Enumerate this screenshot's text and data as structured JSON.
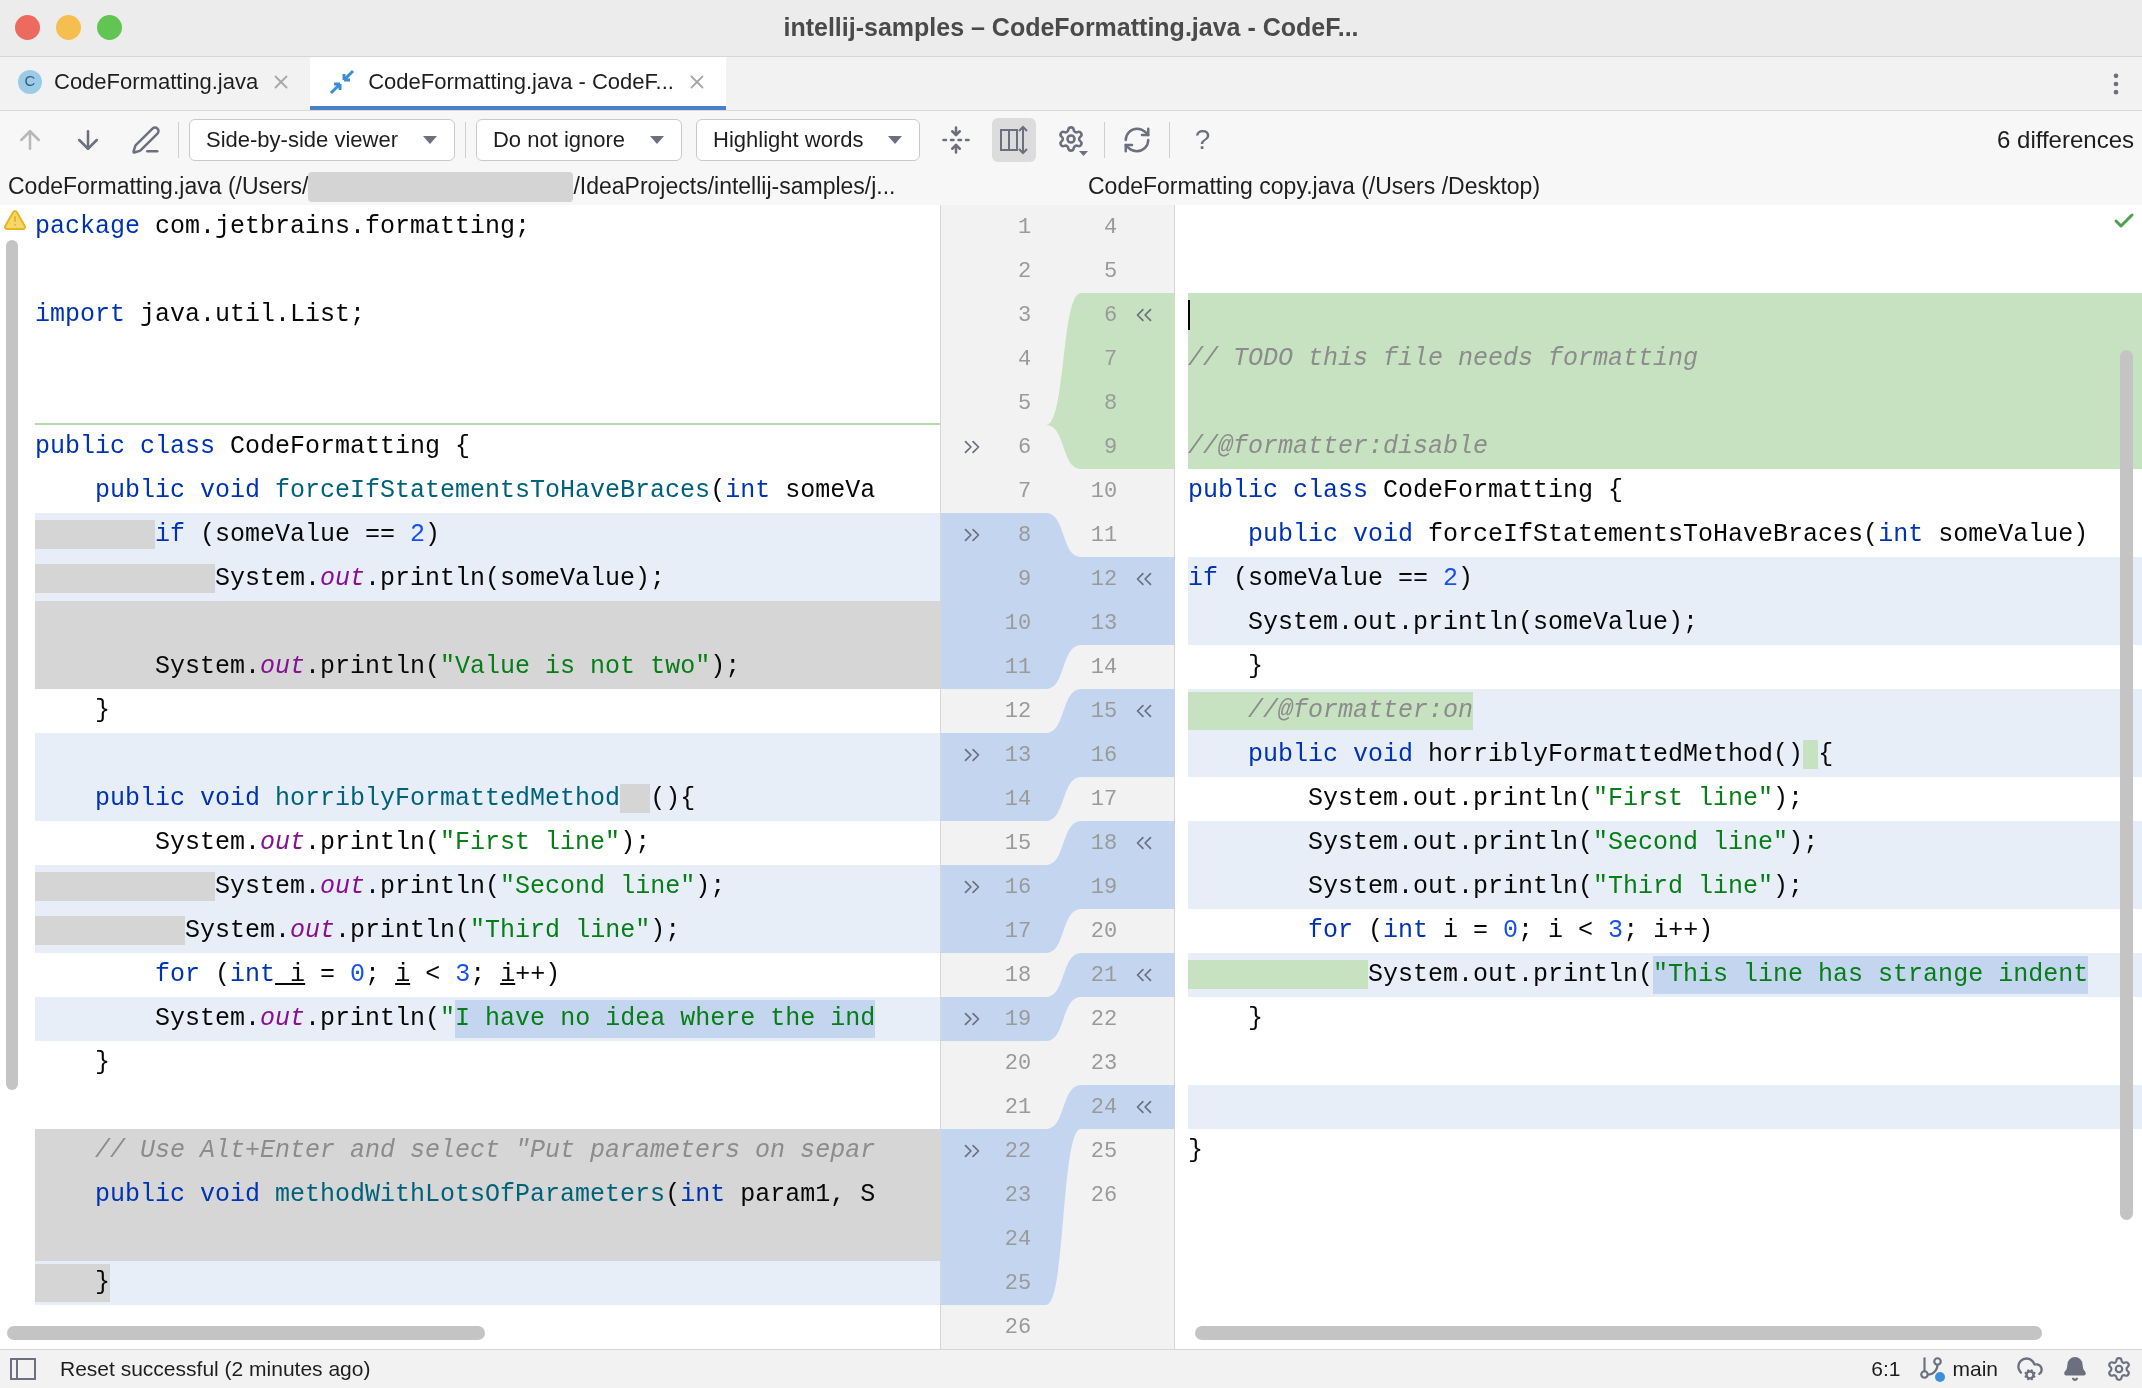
{
  "window": {
    "title": "intellij-samples – CodeFormatting.java - CodeF..."
  },
  "tabs": [
    {
      "label": "CodeFormatting.java",
      "kind": "java_file",
      "icon_text": "C",
      "selected": false
    },
    {
      "label": "CodeFormatting.java - CodeF...",
      "kind": "diff",
      "selected": true
    }
  ],
  "toolbar": {
    "groups": [
      [
        {
          "kind": "prev",
          "disabled": true
        },
        {
          "kind": "next",
          "disabled": false
        },
        {
          "kind": "edit",
          "disabled": false
        }
      ],
      [
        {
          "kind": "dropdown",
          "label": "Side-by-side viewer"
        }
      ],
      [
        {
          "kind": "dropdown",
          "label": "Do not ignore"
        },
        {
          "kind": "dropdown",
          "label": "Highlight words"
        },
        {
          "kind": "collapse",
          "selected": false
        },
        {
          "kind": "sync_scroll",
          "selected": true
        },
        {
          "kind": "settings"
        }
      ],
      [
        {
          "kind": "refresh"
        }
      ],
      [
        {
          "kind": "help",
          "label": "?"
        }
      ]
    ],
    "summary": "6 differences"
  },
  "left": {
    "header_start": "CodeFormatting.java (/Users/",
    "header_end": "/IdeaProjects/intellij-samples/j...",
    "warning": true,
    "lines": [
      {
        "number": "1",
        "kind": "same",
        "tokens": [
          {
            "text": "package",
            "kind": "keyword"
          },
          {
            "text": " com.jetbrains.formatting;",
            "kind": "plain"
          }
        ]
      },
      {
        "number": "2",
        "kind": "same"
      },
      {
        "number": "3",
        "kind": "same",
        "tokens": [
          {
            "text": "import",
            "kind": "keyword"
          },
          {
            "text": " java.util.List;",
            "kind": "plain"
          }
        ]
      },
      {
        "number": "4",
        "kind": "same"
      },
      {
        "number": "5",
        "kind": "same",
        "gap_after": true
      },
      {
        "number": "6",
        "kind": "same",
        "tokens": [
          {
            "text": "public class",
            "kind": "keyword"
          },
          {
            "text": " CodeFormatting {",
            "kind": "plain"
          }
        ]
      },
      {
        "number": "7",
        "kind": "same",
        "tokens": [
          {
            "text": "    public void",
            "kind": "keyword"
          },
          {
            "text": " forceIfStatementsToHaveBraces",
            "kind": "method"
          },
          {
            "text": "(",
            "kind": "plain"
          },
          {
            "text": "int",
            "kind": "keyword"
          },
          {
            "text": " someVa",
            "kind": "plain"
          }
        ]
      },
      {
        "number": "8",
        "kind": "modified",
        "tokens": [
          {
            "text": "        if",
            "kind": "keyword",
            "space_removed": true
          },
          {
            "text": " (someValue == ",
            "kind": "plain"
          },
          {
            "text": "2",
            "kind": "number"
          },
          {
            "text": ")",
            "kind": "plain"
          }
        ]
      },
      {
        "number": "9",
        "kind": "modified",
        "tokens": [
          {
            "text": "            System.",
            "kind": "plain",
            "space_removed": true
          },
          {
            "text": "out",
            "kind": "field"
          },
          {
            "text": ".println(someValue);",
            "kind": "plain"
          }
        ]
      },
      {
        "number": "10",
        "kind": "removed"
      },
      {
        "number": "11",
        "kind": "removed",
        "tokens": [
          {
            "text": "        System.",
            "kind": "plain"
          },
          {
            "text": "out",
            "kind": "field"
          },
          {
            "text": ".println(",
            "kind": "plain"
          },
          {
            "text": "\"Value is not two\"",
            "kind": "string"
          },
          {
            "text": ");",
            "kind": "plain"
          }
        ]
      },
      {
        "number": "12",
        "kind": "same",
        "tokens": [
          {
            "text": "    }",
            "kind": "plain"
          }
        ]
      },
      {
        "number": "13",
        "kind": "modified"
      },
      {
        "number": "14",
        "kind": "modified",
        "tokens": [
          {
            "text": "    public void",
            "kind": "keyword"
          },
          {
            "text": " horriblyFormattedMethod",
            "kind": "method"
          },
          {
            "text": "  (){",
            "kind": "plain",
            "space_removed": true
          }
        ]
      },
      {
        "number": "15",
        "kind": "same",
        "tokens": [
          {
            "text": "        System.",
            "kind": "plain"
          },
          {
            "text": "out",
            "kind": "field"
          },
          {
            "text": ".println(",
            "kind": "plain"
          },
          {
            "text": "\"First line\"",
            "kind": "string"
          },
          {
            "text": ");",
            "kind": "plain"
          }
        ]
      },
      {
        "number": "16",
        "kind": "modified",
        "tokens": [
          {
            "text": "            System.",
            "kind": "plain",
            "space_removed": true
          },
          {
            "text": "out",
            "kind": "field"
          },
          {
            "text": ".println(",
            "kind": "plain"
          },
          {
            "text": "\"Second line\"",
            "kind": "string"
          },
          {
            "text": ");",
            "kind": "plain"
          }
        ]
      },
      {
        "number": "17",
        "kind": "modified",
        "tokens": [
          {
            "text": "          System.",
            "kind": "plain",
            "space_removed": true
          },
          {
            "text": "out",
            "kind": "field"
          },
          {
            "text": ".println(",
            "kind": "plain"
          },
          {
            "text": "\"Third line\"",
            "kind": "string"
          },
          {
            "text": ");",
            "kind": "plain"
          }
        ]
      },
      {
        "number": "18",
        "kind": "same",
        "tokens": [
          {
            "text": "        for",
            "kind": "keyword"
          },
          {
            "text": " (",
            "kind": "plain"
          },
          {
            "text": "int",
            "kind": "keyword"
          },
          {
            "text": " i",
            "kind": "local"
          },
          {
            "text": " = ",
            "kind": "plain"
          },
          {
            "text": "0",
            "kind": "number"
          },
          {
            "text": "; ",
            "kind": "plain"
          },
          {
            "text": "i",
            "kind": "local"
          },
          {
            "text": " < ",
            "kind": "plain"
          },
          {
            "text": "3",
            "kind": "number"
          },
          {
            "text": "; ",
            "kind": "plain"
          },
          {
            "text": "i",
            "kind": "local"
          },
          {
            "text": "++)",
            "kind": "plain"
          }
        ]
      },
      {
        "number": "19",
        "kind": "modified",
        "tokens": [
          {
            "text": "        System.",
            "kind": "plain"
          },
          {
            "text": "out",
            "kind": "field"
          },
          {
            "text": ".println(",
            "kind": "plain"
          },
          {
            "text": "\"",
            "kind": "string"
          },
          {
            "text": "I have no idea where the ind",
            "kind": "string",
            "changed": true
          }
        ]
      },
      {
        "number": "20",
        "kind": "same",
        "tokens": [
          {
            "text": "    }",
            "kind": "plain"
          }
        ]
      },
      {
        "number": "21",
        "kind": "same"
      },
      {
        "number": "22",
        "kind": "removed",
        "tokens": [
          {
            "text": "    // Use Alt+Enter and select \"Put parameters on separ",
            "kind": "comment"
          }
        ]
      },
      {
        "number": "23",
        "kind": "removed",
        "tokens": [
          {
            "text": "    public void",
            "kind": "keyword"
          },
          {
            "text": " methodWithLotsOfParameters",
            "kind": "method"
          },
          {
            "text": "(",
            "kind": "plain"
          },
          {
            "text": "int",
            "kind": "keyword"
          },
          {
            "text": " param1, S",
            "kind": "plain"
          }
        ]
      },
      {
        "number": "24",
        "kind": "removed"
      },
      {
        "number": "25",
        "kind": "modified",
        "tokens": [
          {
            "text": "    }",
            "kind": "plain",
            "removed": true
          }
        ]
      },
      {
        "number": "26",
        "kind": "same"
      }
    ]
  },
  "right": {
    "header": "CodeFormatting copy.java (/Users /Desktop)",
    "ok": true,
    "lines": [
      {
        "number": "4",
        "kind": "same"
      },
      {
        "number": "5",
        "kind": "same"
      },
      {
        "number": "6",
        "kind": "inserted",
        "cursor": true
      },
      {
        "number": "7",
        "kind": "inserted",
        "tokens": [
          {
            "text": "// TODO this file needs formatting",
            "kind": "comment"
          }
        ]
      },
      {
        "number": "8",
        "kind": "inserted"
      },
      {
        "number": "9",
        "kind": "inserted",
        "tokens": [
          {
            "text": "//@formatter:disable",
            "kind": "comment"
          }
        ]
      },
      {
        "number": "10",
        "kind": "same",
        "tokens": [
          {
            "text": "public class",
            "kind": "keyword"
          },
          {
            "text": " CodeFormatting {",
            "kind": "plain"
          }
        ]
      },
      {
        "number": "11",
        "kind": "same",
        "tokens": [
          {
            "text": "    public void",
            "kind": "keyword"
          },
          {
            "text": " forceIfStatementsToHaveBraces(",
            "kind": "plain"
          },
          {
            "text": "int",
            "kind": "keyword"
          },
          {
            "text": " someValue)",
            "kind": "plain"
          }
        ]
      },
      {
        "number": "12",
        "kind": "modified",
        "tokens": [
          {
            "text": "if",
            "kind": "keyword"
          },
          {
            "text": " (someValue == ",
            "kind": "plain"
          },
          {
            "text": "2",
            "kind": "number"
          },
          {
            "text": ")",
            "kind": "plain"
          }
        ]
      },
      {
        "number": "13",
        "kind": "modified",
        "tokens": [
          {
            "text": "    System.out.println(someValue);",
            "kind": "plain"
          }
        ]
      },
      {
        "number": "14",
        "kind": "same",
        "tokens": [
          {
            "text": "    }",
            "kind": "plain"
          }
        ]
      },
      {
        "number": "15",
        "kind": "modified",
        "tokens": [
          {
            "text": "    //@formatter:on",
            "kind": "comment",
            "added": true
          }
        ]
      },
      {
        "number": "16",
        "kind": "modified",
        "tokens": [
          {
            "text": "    public void",
            "kind": "keyword"
          },
          {
            "text": " horriblyFormattedMethod()",
            "kind": "plain"
          },
          {
            "text": " {",
            "kind": "plain",
            "space_added": true
          }
        ]
      },
      {
        "number": "17",
        "kind": "same",
        "tokens": [
          {
            "text": "        System.out.println(",
            "kind": "plain"
          },
          {
            "text": "\"First line\"",
            "kind": "string"
          },
          {
            "text": ");",
            "kind": "plain"
          }
        ]
      },
      {
        "number": "18",
        "kind": "modified",
        "tokens": [
          {
            "text": "        System.out.println(",
            "kind": "plain"
          },
          {
            "text": "\"Second line\"",
            "kind": "string"
          },
          {
            "text": ");",
            "kind": "plain"
          }
        ]
      },
      {
        "number": "19",
        "kind": "modified",
        "tokens": [
          {
            "text": "        System.out.println(",
            "kind": "plain"
          },
          {
            "text": "\"Third line\"",
            "kind": "string"
          },
          {
            "text": ");",
            "kind": "plain"
          }
        ]
      },
      {
        "number": "20",
        "kind": "same",
        "tokens": [
          {
            "text": "        for",
            "kind": "keyword"
          },
          {
            "text": " (",
            "kind": "plain"
          },
          {
            "text": "int",
            "kind": "keyword"
          },
          {
            "text": " i = ",
            "kind": "plain"
          },
          {
            "text": "0",
            "kind": "number"
          },
          {
            "text": "; i < ",
            "kind": "plain"
          },
          {
            "text": "3",
            "kind": "number"
          },
          {
            "text": "; i++)",
            "kind": "plain"
          }
        ]
      },
      {
        "number": "21",
        "kind": "modified",
        "tokens": [
          {
            "text": "            System.out.println(",
            "kind": "plain",
            "space_added": true
          },
          {
            "text": "\"This line has strange indent",
            "kind": "string",
            "changed": true
          }
        ]
      },
      {
        "number": "22",
        "kind": "same",
        "tokens": [
          {
            "text": "    }",
            "kind": "plain"
          }
        ]
      },
      {
        "number": "23",
        "kind": "same"
      },
      {
        "number": "24",
        "kind": "modified"
      },
      {
        "number": "25",
        "kind": "same",
        "tokens": [
          {
            "text": "}",
            "kind": "plain"
          }
        ]
      },
      {
        "number": "26",
        "kind": "same"
      }
    ]
  },
  "status_bar": {
    "message": "Reset successful (2 minutes ago)",
    "position": "6:1",
    "branch": "main"
  }
}
